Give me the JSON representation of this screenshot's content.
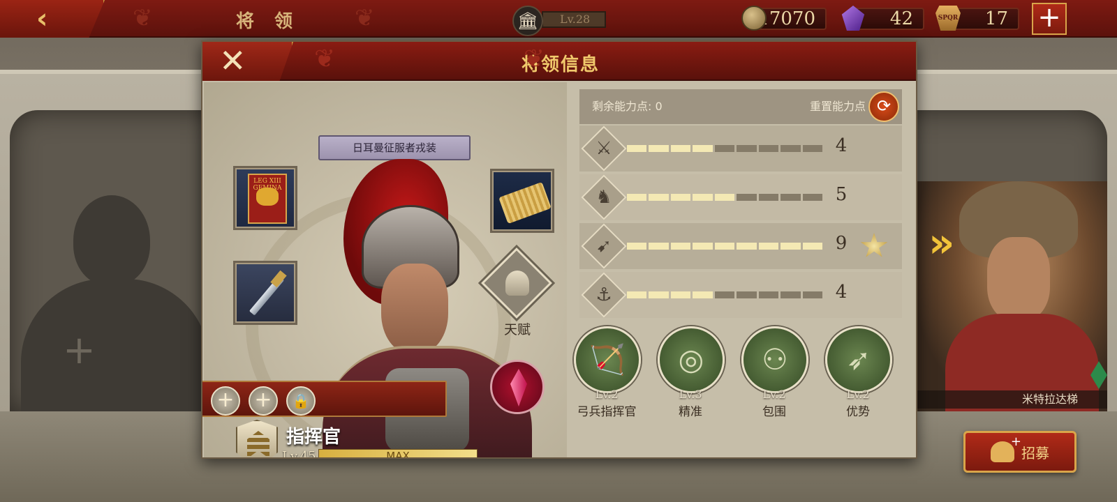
{
  "topbar": {
    "title": "将 领",
    "building_level": "Lv.28",
    "resources": [
      {
        "icon": "coin-icon",
        "value": "17070"
      },
      {
        "icon": "gem-icon",
        "value": "42"
      },
      {
        "icon": "spqr-token-icon",
        "value": "17"
      }
    ],
    "add_label": "+"
  },
  "background": {
    "right_hero_name": "米特拉达梯",
    "recruit_label": "招募"
  },
  "modal": {
    "title": "将领信息",
    "close_label": "✕",
    "skin_label": "日耳曼征服者戎装",
    "banner_text": "LEG XIII GEMINA",
    "talent_label": "天赋",
    "rank_name": "指挥官",
    "level": "Lv.45",
    "exp_label": "MAX",
    "exp_fraction": 1.0,
    "stats": {
      "remaining_label": "剩余能力点:",
      "remaining_value": "0",
      "reset_label": "重置能力点",
      "rows": [
        {
          "icon": "sword-icon",
          "value": "4",
          "filled": 4
        },
        {
          "icon": "horse-icon",
          "value": "5",
          "filled": 5
        },
        {
          "icon": "bow-icon",
          "value": "9",
          "filled": 9,
          "badge": "star-badge-icon"
        },
        {
          "icon": "anchor-icon",
          "value": "4",
          "filled": 4
        }
      ],
      "segments_total": 9
    },
    "skills": [
      {
        "icon": "bow-skill-icon",
        "level": "Lv.2",
        "name": "弓兵指挥官"
      },
      {
        "icon": "target-skill-icon",
        "level": "Lv.3",
        "name": "精准"
      },
      {
        "icon": "encircle-skill-icon",
        "level": "Lv.2",
        "name": "包围"
      },
      {
        "icon": "archers-skill-icon",
        "level": "Lv.2",
        "name": "优势"
      }
    ]
  }
}
